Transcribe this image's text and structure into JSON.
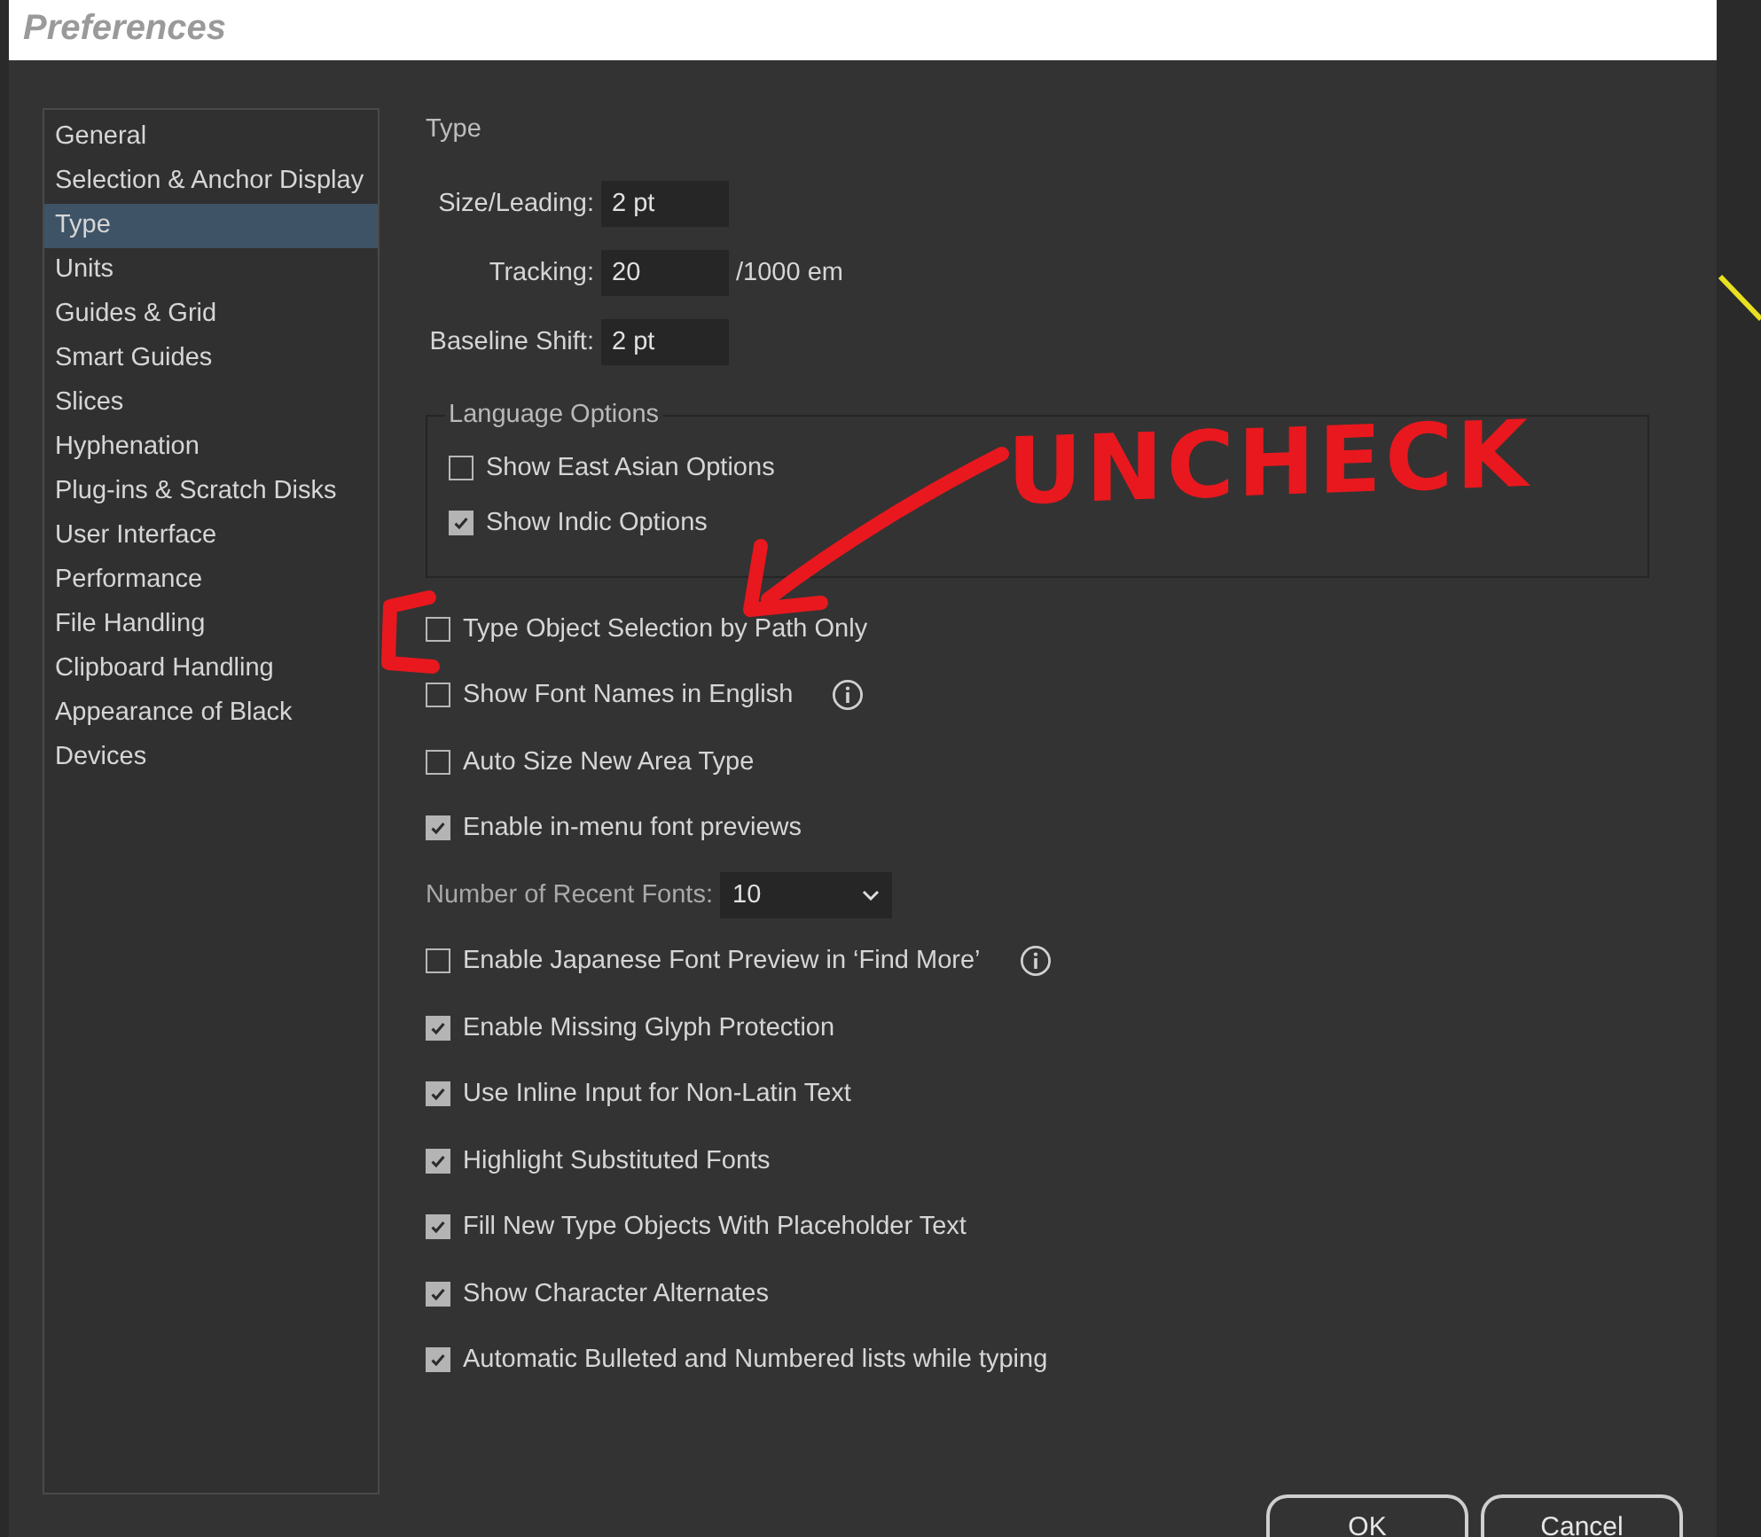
{
  "window": {
    "title": "Preferences"
  },
  "sidebar": {
    "items": [
      {
        "label": "General",
        "selected": false
      },
      {
        "label": "Selection & Anchor Display",
        "selected": false
      },
      {
        "label": "Type",
        "selected": true
      },
      {
        "label": "Units",
        "selected": false
      },
      {
        "label": "Guides & Grid",
        "selected": false
      },
      {
        "label": "Smart Guides",
        "selected": false
      },
      {
        "label": "Slices",
        "selected": false
      },
      {
        "label": "Hyphenation",
        "selected": false
      },
      {
        "label": "Plug-ins & Scratch Disks",
        "selected": false
      },
      {
        "label": "User Interface",
        "selected": false
      },
      {
        "label": "Performance",
        "selected": false
      },
      {
        "label": "File Handling",
        "selected": false
      },
      {
        "label": "Clipboard Handling",
        "selected": false
      },
      {
        "label": "Appearance of Black",
        "selected": false
      },
      {
        "label": "Devices",
        "selected": false
      }
    ]
  },
  "section_title": "Type",
  "fields": [
    {
      "label": "Size/Leading:",
      "value": "2 pt"
    },
    {
      "label": "Tracking:",
      "value": "20",
      "unit": "/1000 em"
    },
    {
      "label": "Baseline Shift:",
      "value": "2 pt"
    }
  ],
  "language_options": {
    "title": "Language Options",
    "options": [
      {
        "label": "Show East Asian Options",
        "checked": false
      },
      {
        "label": "Show Indic Options",
        "checked": true
      }
    ]
  },
  "options": [
    {
      "kind": "checkbox",
      "label": "Type Object Selection by Path Only",
      "checked": false
    },
    {
      "kind": "checkbox",
      "label": "Show Font Names in English",
      "checked": false,
      "info": true
    },
    {
      "kind": "checkbox",
      "label": "Auto Size New Area Type",
      "checked": false
    },
    {
      "kind": "checkbox",
      "label": "Enable in-menu font previews",
      "checked": true
    },
    {
      "kind": "select",
      "label": "Number of Recent Fonts:",
      "value": "10"
    },
    {
      "kind": "checkbox",
      "label": "Enable Japanese Font Preview in ‘Find More’",
      "checked": false,
      "info": true
    },
    {
      "kind": "checkbox",
      "label": "Enable Missing Glyph Protection",
      "checked": true
    },
    {
      "kind": "checkbox",
      "label": "Use Inline Input for Non-Latin Text",
      "checked": true
    },
    {
      "kind": "checkbox",
      "label": "Highlight Substituted Fonts",
      "checked": true
    },
    {
      "kind": "checkbox",
      "label": "Fill New Type Objects With Placeholder Text",
      "checked": true
    },
    {
      "kind": "checkbox",
      "label": "Show Character Alternates",
      "checked": true
    },
    {
      "kind": "checkbox",
      "label": "Automatic Bulleted and Numbered lists while typing",
      "checked": true
    }
  ],
  "buttons": [
    "OK",
    "Cancel"
  ],
  "annotation": {
    "text": "UNCHECK"
  }
}
